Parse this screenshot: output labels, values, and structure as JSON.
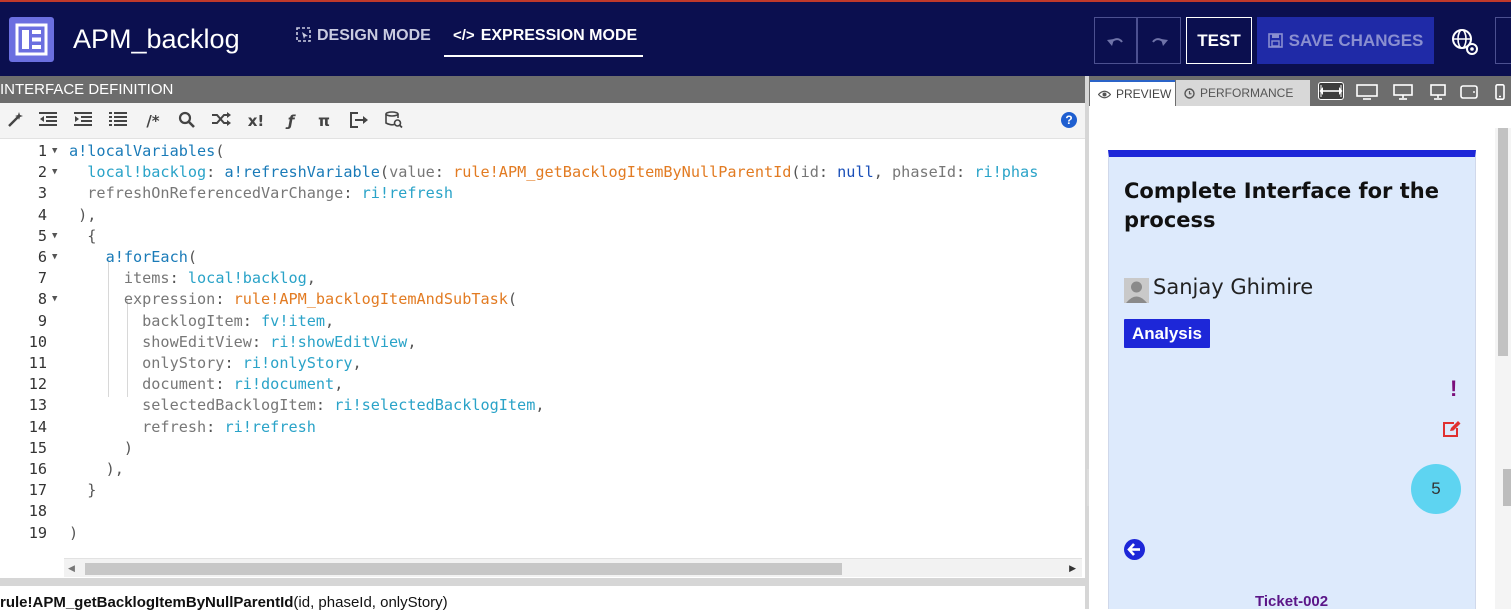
{
  "header": {
    "app_title": "APM_backlog",
    "modes": [
      "DESIGN MODE",
      "EXPRESSION MODE"
    ],
    "active_mode": "EXPRESSION MODE",
    "test_label": "TEST",
    "save_label": "SAVE CHANGES",
    "colors": {
      "bar": "#0b0f4f",
      "logo": "#6b6fe0",
      "save_button": "#1f2aa7"
    }
  },
  "editor": {
    "section_title": "INTERFACE DEFINITION",
    "toolbar_icons": [
      "magic-wand-icon",
      "outdent-icon",
      "indent-icon",
      "format-icon",
      "comment-icon",
      "search-icon",
      "shuffle-icon",
      "function-x-icon",
      "fx-icon",
      "pi-icon",
      "sign-out-icon",
      "database-search-icon",
      "help-icon"
    ],
    "toolbar_glyphs": [
      "/*",
      "x!",
      "ƒ",
      "π",
      "?"
    ],
    "line_numbers": [
      "1",
      "2",
      "3",
      "4",
      "5",
      "6",
      "7",
      "8",
      "9",
      "10",
      "11",
      "12",
      "13",
      "14",
      "15",
      "16",
      "17",
      "18",
      "19"
    ],
    "lines": [
      [
        {
          "t": "a!localVariables",
          "c": "k-fn"
        },
        {
          "t": "(",
          "c": "k-punc"
        }
      ],
      [
        {
          "t": "  local!backlog",
          "c": "k-var"
        },
        {
          "t": ": ",
          "c": "k-punc"
        },
        {
          "t": "a!refreshVariable",
          "c": "k-fn"
        },
        {
          "t": "(",
          "c": "k-punc"
        },
        {
          "t": "value",
          "c": "k-plain"
        },
        {
          "t": ": ",
          "c": "k-punc"
        },
        {
          "t": "rule!APM_getBacklogItemByNullParentId",
          "c": "k-rule"
        },
        {
          "t": "(",
          "c": "k-punc"
        },
        {
          "t": "id",
          "c": "k-plain"
        },
        {
          "t": ": ",
          "c": "k-punc"
        },
        {
          "t": "null",
          "c": "k-kw"
        },
        {
          "t": ", ",
          "c": "k-punc"
        },
        {
          "t": "phaseId",
          "c": "k-plain"
        },
        {
          "t": ": ",
          "c": "k-punc"
        },
        {
          "t": "ri!phas",
          "c": "k-var"
        }
      ],
      [
        {
          "t": "  refreshOnReferencedVarChange",
          "c": "k-plain"
        },
        {
          "t": ": ",
          "c": "k-punc"
        },
        {
          "t": "ri!refresh",
          "c": "k-var"
        }
      ],
      [
        {
          "t": " ),",
          "c": "k-punc"
        }
      ],
      [
        {
          "t": "  {",
          "c": "k-punc"
        }
      ],
      [
        {
          "t": "    a!forEach",
          "c": "k-fn"
        },
        {
          "t": "(",
          "c": "k-punc"
        }
      ],
      [
        {
          "t": "      items",
          "c": "k-plain"
        },
        {
          "t": ": ",
          "c": "k-punc"
        },
        {
          "t": "local!backlog",
          "c": "k-var"
        },
        {
          "t": ",",
          "c": "k-punc"
        }
      ],
      [
        {
          "t": "      expression",
          "c": "k-plain"
        },
        {
          "t": ": ",
          "c": "k-punc"
        },
        {
          "t": "rule!APM_backlogItemAndSubTask",
          "c": "k-rule"
        },
        {
          "t": "(",
          "c": "k-punc"
        }
      ],
      [
        {
          "t": "        backlogItem",
          "c": "k-plain"
        },
        {
          "t": ": ",
          "c": "k-punc"
        },
        {
          "t": "fv!item",
          "c": "k-var"
        },
        {
          "t": ",",
          "c": "k-punc"
        }
      ],
      [
        {
          "t": "        showEditView",
          "c": "k-plain"
        },
        {
          "t": ": ",
          "c": "k-punc"
        },
        {
          "t": "ri!showEditView",
          "c": "k-var"
        },
        {
          "t": ",",
          "c": "k-punc"
        }
      ],
      [
        {
          "t": "        onlyStory",
          "c": "k-plain"
        },
        {
          "t": ": ",
          "c": "k-punc"
        },
        {
          "t": "ri!onlyStory",
          "c": "k-var"
        },
        {
          "t": ",",
          "c": "k-punc"
        }
      ],
      [
        {
          "t": "        document",
          "c": "k-plain"
        },
        {
          "t": ": ",
          "c": "k-punc"
        },
        {
          "t": "ri!document",
          "c": "k-var"
        },
        {
          "t": ",",
          "c": "k-punc"
        }
      ],
      [
        {
          "t": "        selectedBacklogItem",
          "c": "k-plain"
        },
        {
          "t": ": ",
          "c": "k-punc"
        },
        {
          "t": "ri!selectedBacklogItem",
          "c": "k-var"
        },
        {
          "t": ",",
          "c": "k-punc"
        }
      ],
      [
        {
          "t": "        refresh",
          "c": "k-plain"
        },
        {
          "t": ": ",
          "c": "k-punc"
        },
        {
          "t": "ri!refresh",
          "c": "k-var"
        }
      ],
      [
        {
          "t": "      )",
          "c": "k-punc"
        }
      ],
      [
        {
          "t": "    ),",
          "c": "k-punc"
        }
      ],
      [
        {
          "t": "  }",
          "c": "k-punc"
        }
      ],
      [
        {
          "t": "",
          "c": "k-punc"
        }
      ],
      [
        {
          "t": ")",
          "c": "k-punc"
        }
      ]
    ],
    "folds": [
      true,
      true,
      false,
      false,
      true,
      true,
      false,
      true,
      false,
      false,
      false,
      false,
      false,
      false,
      false,
      false,
      false,
      false,
      false
    ],
    "signature_name": "rule!APM_getBacklogItemByNullParentId",
    "signature_args": "(id, phaseId, onlyStory)"
  },
  "preview": {
    "tabs": [
      "PREVIEW",
      "PERFORMANCE"
    ],
    "active_tab": "PREVIEW",
    "device_icons": [
      "fit-width-icon",
      "monitor-icon",
      "desktop-icon",
      "laptop-icon",
      "tablet-icon",
      "phone-icon"
    ],
    "card": {
      "title": "Complete Interface for the process",
      "user_name": "Sanjay Ghimire",
      "status": "Analysis",
      "priority_symbol": "!",
      "story_points": "5",
      "ticket_id": "Ticket-002",
      "colors": {
        "accent": "#1d27d8",
        "background": "#ddeafc",
        "points": "#5ed4f1",
        "priority": "#7a0f7a",
        "edit": "#e03030",
        "ticket": "#5b1688"
      }
    }
  }
}
